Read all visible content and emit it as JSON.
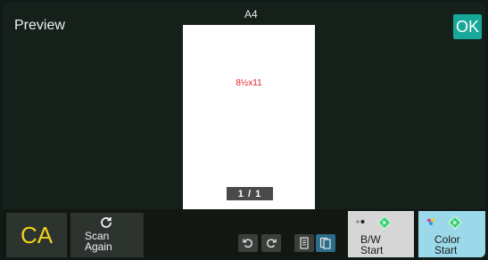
{
  "screen": {
    "title": "Preview",
    "paper_size": "A4",
    "ok_label": "OK"
  },
  "preview": {
    "page_label": "8½x11",
    "page_counter": "1 / 1"
  },
  "bottom": {
    "ca_label": "CA",
    "scan_again_label": "Scan\nAgain",
    "bw_start_label": "B/W\nStart",
    "color_start_label": "Color\nStart"
  },
  "icons": {
    "scan_again": "refresh-icon",
    "rotate_left": "rotate-left-icon",
    "rotate_right": "rotate-right-icon",
    "single_page": "single-page-icon",
    "multi_page": "multi-page-icon",
    "bw_start": "start-diamond-icon",
    "color_start": "start-diamond-icon"
  },
  "colors": {
    "ok_button": "#18a89a",
    "ca_text": "#f2d21a",
    "bw_start_bg": "#d6d6d6",
    "color_start_bg": "#9bd9ea",
    "start_diamond": "#3bd17a",
    "page_label": "#e02020"
  }
}
